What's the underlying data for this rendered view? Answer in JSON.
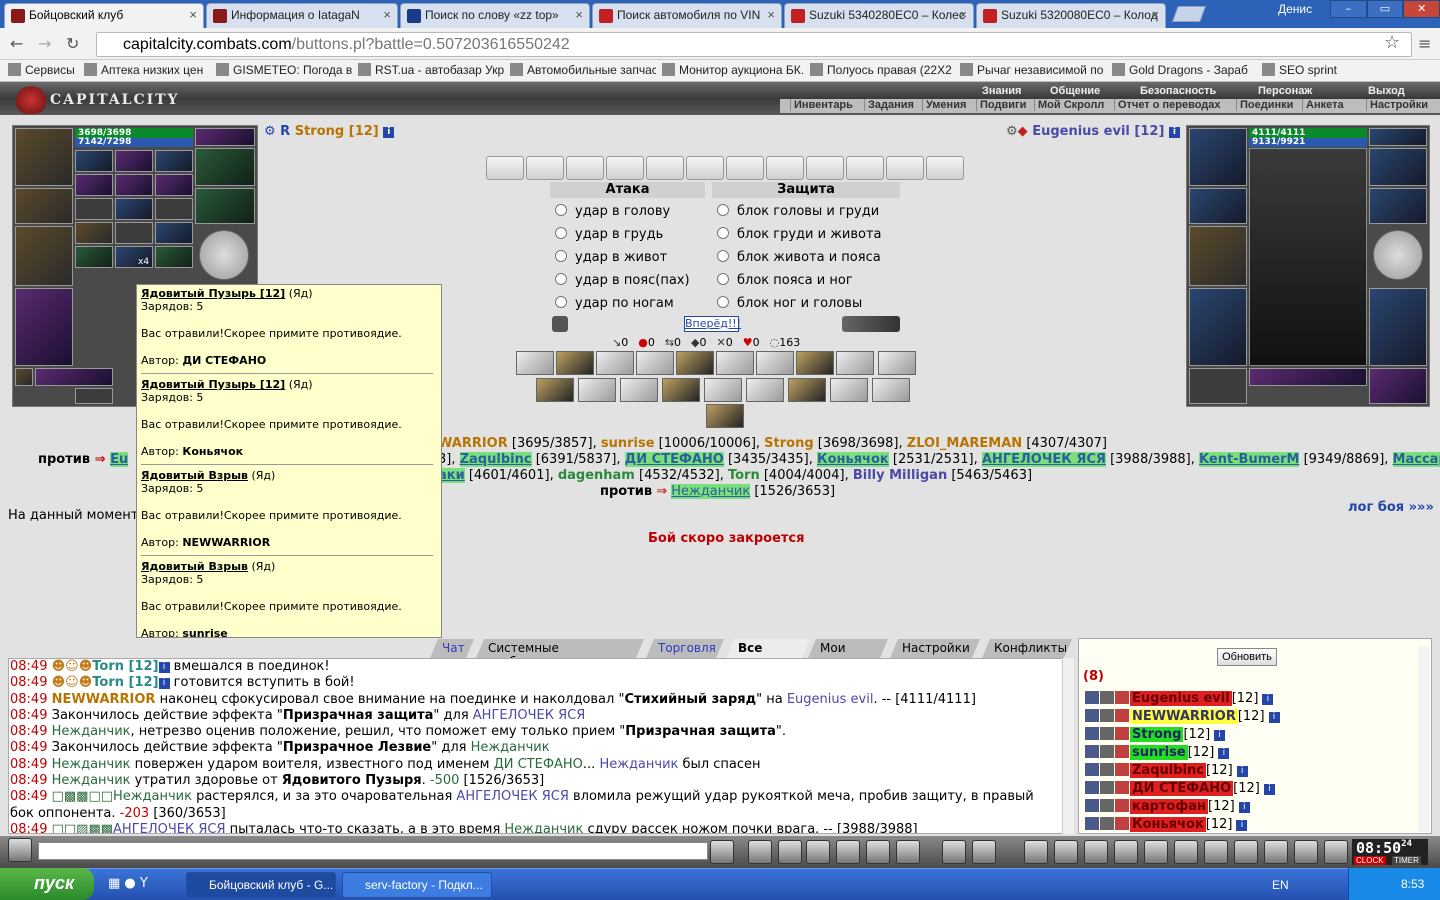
{
  "browser": {
    "tabs": [
      {
        "title": "Бойцовский клуб",
        "color": "#8a1a1a"
      },
      {
        "title": "Информация о IatagaN",
        "color": "#8a1a1a"
      },
      {
        "title": "Поиск по слову «zz top»",
        "color": "#1a3a8a"
      },
      {
        "title": "Поиск автомобиля по VIN",
        "color": "#c02020"
      },
      {
        "title": "Suzuki 5340280EC0 – Колес",
        "color": "#c02020"
      },
      {
        "title": "Suzuki 5320080EC0 – Колод",
        "color": "#c02020"
      }
    ],
    "user": "Денис",
    "url_host": "capitalcity.combats.com",
    "url_rest": "/buttons.pl?battle=0.507203616550242",
    "bookmarks": [
      "Сервисы",
      "Аптека низких цен",
      "GISMETEO: Погода в У",
      "RST.ua - автобазар Укр",
      "Автомобильные запчас",
      "Монитор аукциона БК.",
      "Полуось правая (22X2",
      "Рычаг независимой по",
      "Gold Dragons - Зараб",
      "SEO sprint"
    ]
  },
  "game": {
    "logo": "CAPITALCITY",
    "menu_top": [
      "Знания",
      "Общение",
      "Безопасность",
      "Персонаж",
      "Выход"
    ],
    "menu_bottom": [
      "Инвентарь",
      "Задания",
      "Умения",
      "Подвиги",
      "Мой Скролл",
      "Отчет о переводах",
      "Поединки",
      "Анкета",
      "Настройки"
    ],
    "left": {
      "hp": "3698/3698",
      "mp": "7142/7298",
      "name": "Strong",
      "level": "[12]",
      "count_badge": "x4"
    },
    "right": {
      "hp": "4111/4111",
      "mp": "9131/9921",
      "name": "Eugenius evil",
      "level": "[12]"
    },
    "attack": {
      "title": "Атака",
      "options": [
        "удар в голову",
        "удар в грудь",
        "удар в живот",
        "удар в пояс(пах)",
        "удар по ногам"
      ]
    },
    "defense": {
      "title": "Защита",
      "options": [
        "блок головы и груди",
        "блок груди и живота",
        "блок живота и пояса",
        "блок пояса и ног",
        "блок ног и головы"
      ]
    },
    "forward": "Вперёд!!!",
    "stats": [
      "0",
      "0",
      "0",
      "0",
      "0",
      "0",
      "163"
    ],
    "tooltip": [
      {
        "name": "Ядовитый Пузырь [12]",
        "type": "(Яд)",
        "charges": "Зарядов: 5",
        "desc": "Вас отравили!Скорее примите противоядие.",
        "author_label": "Автор:",
        "author": "ДИ СТЕФАНО"
      },
      {
        "name": "Ядовитый Пузырь [12]",
        "type": "(Яд)",
        "charges": "Зарядов: 5",
        "desc": "Вас отравили!Скорее примите противоядие.",
        "author_label": "Автор:",
        "author": "Коньячок"
      },
      {
        "name": "Ядовитый Взрыв",
        "type": "(Яд)",
        "charges": "Зарядов: 5",
        "desc": "Вас отравили!Скорее примите противоядие.",
        "author_label": "Автор:",
        "author": "NEWWARRIOR"
      },
      {
        "name": "Ядовитый Взрыв",
        "type": "(Яд)",
        "charges": "Зарядов: 5",
        "desc": "Вас отравили!Скорее примите противоядие.",
        "author_label": "Автор:",
        "author": "sunrise"
      }
    ],
    "roster": {
      "line1": [
        [
          "WARRIOR",
          "[3695/3857]"
        ],
        [
          "sunrise",
          "[10006/10006]"
        ],
        [
          "Strong",
          "[3698/3698]"
        ],
        [
          "ZLOI_MAREMAN",
          "[4307/4307]"
        ]
      ],
      "line2": [
        [
          "Zaqulbinc",
          "[6391/5837]"
        ],
        [
          "ДИ СТЕФАНО",
          "[3435/3435]"
        ],
        [
          "Коньячок",
          "[2531/2531]"
        ],
        [
          "АНГЕЛОЧЕК ЯСЯ",
          "[3988/3988]"
        ],
        [
          "Kent-BumerM",
          "[9349/8869]"
        ],
        [
          "Массар-"
        ]
      ],
      "line3": [
        [
          "аки",
          "[4601/4601]"
        ],
        [
          "dagenham",
          "[4532/4532]"
        ],
        [
          "Torn",
          "[4004/4004]"
        ],
        [
          "Billy Milligan",
          "[5463/5463]"
        ]
      ],
      "vs": "против",
      "vs_left_name": "Eu",
      "vs_name": "Нежданчик",
      "vs_hp": "[1526/3653]",
      "line2_prefix_hp": "3]"
    },
    "at_moment": "На данный момент",
    "log_link": "лог боя »»»",
    "closing": "Бой скоро закроется"
  },
  "chat_tabs": [
    "Чат",
    "Системные сообщения",
    "Торговля",
    "Все логи",
    "Мои логи",
    "Настройки",
    "Конфликты"
  ],
  "chat": [
    {
      "t": "08:49",
      "parts": [
        [
          "Torn [12]",
          "nk"
        ],
        [
          " вмешался в поединок!",
          ""
        ]
      ]
    },
    {
      "t": "08:49",
      "parts": [
        [
          "Torn [12]",
          "nk"
        ],
        [
          " готовится вступить в бой!",
          ""
        ]
      ]
    },
    {
      "t": "08:49",
      "parts": [
        [
          "NEWWARRIOR",
          "or"
        ],
        [
          " наконец сфокусировал свое внимание на поединке и наколдовал \"",
          ""
        ],
        [
          "Стихийный заряд",
          "b"
        ],
        [
          "\" на ",
          ""
        ],
        [
          "Eugenius evil",
          "bl"
        ],
        [
          ". -- [4111/4111]",
          ""
        ]
      ]
    },
    {
      "t": "08:49",
      "parts": [
        [
          "Закончилось действие эффекта \"",
          ""
        ],
        [
          "Призрачная защита",
          "b"
        ],
        [
          "\" для ",
          ""
        ],
        [
          "АНГЕЛОЧЕК ЯСЯ",
          "bl"
        ]
      ]
    },
    {
      "t": "08:49",
      "parts": [
        [
          "Нежданчик",
          "ppl"
        ],
        [
          ", нетрезво оценив положение, решил, что поможет ему только прием \"",
          ""
        ],
        [
          "Призрачная защита",
          "b"
        ],
        [
          "\".",
          ""
        ]
      ]
    },
    {
      "t": "08:49",
      "parts": [
        [
          "Закончилось действие эффекта \"",
          ""
        ],
        [
          "Призрачное Лезвие",
          "b"
        ],
        [
          "\" для ",
          ""
        ],
        [
          "Нежданчик",
          "ppl"
        ]
      ]
    },
    {
      "t": "08:49",
      "parts": [
        [
          "Нежданчик",
          "ppl"
        ],
        [
          " повержен ударом воителя, известного под именем ",
          ""
        ],
        [
          "ДИ СТЕФАНО",
          "ppl"
        ],
        [
          "... ",
          ""
        ],
        [
          "Нежданчик",
          "bl"
        ],
        [
          " был спасен",
          ""
        ]
      ]
    },
    {
      "t": "08:49",
      "parts": [
        [
          "Нежданчик",
          "ppl"
        ],
        [
          " утратил здоровье от ",
          ""
        ],
        [
          "Ядовитого Пузыря",
          "b"
        ],
        [
          ". ",
          ""
        ],
        [
          "-500",
          "ppl"
        ],
        [
          " [1526/3653]",
          ""
        ]
      ]
    },
    {
      "t": "08:49",
      "parts": [
        [
          "□▩▩□□",
          "ppl"
        ],
        [
          "Нежданчик",
          "ppl"
        ],
        [
          " растерялся, и за это очаровательная ",
          ""
        ],
        [
          "АНГЕЛОЧЕК ЯСЯ",
          "bl"
        ],
        [
          " вломила режущий удар рукояткой меча, пробив защиту, в правый",
          ""
        ]
      ]
    },
    {
      "t": "",
      "parts": [
        [
          "бок оппонента. ",
          ""
        ],
        [
          "-203",
          "red"
        ],
        [
          " [360/3653]",
          ""
        ]
      ]
    },
    {
      "t": "08:49",
      "parts": [
        [
          "□□▨▩▩",
          "ppl"
        ],
        [
          "АНГЕЛОЧЕК ЯСЯ",
          "bl"
        ],
        [
          " пыталась что-то сказать, а в это время ",
          ""
        ],
        [
          "Нежданчик",
          "ppl"
        ],
        [
          " сдуру рассек ножом почки врага. -- [3988/3988]",
          ""
        ]
      ]
    }
  ],
  "side": {
    "refresh": "Обновить",
    "count": "(8)",
    "players": [
      {
        "name": "Eugenius evil",
        "level": "[12]",
        "style": "nmr"
      },
      {
        "name": "NEWWARRIOR",
        "level": "[12]",
        "style": "nmy"
      },
      {
        "name": "Strong",
        "level": "[12]",
        "style": "nmg"
      },
      {
        "name": "sunrise",
        "level": "[12]",
        "style": "nmg"
      },
      {
        "name": "Zaqulbinc",
        "level": "[12]",
        "style": "nmr"
      },
      {
        "name": "ДИ СТЕФАНО",
        "level": "[12]",
        "style": "nmr"
      },
      {
        "name": "картофан",
        "level": "[12]",
        "style": "nmr"
      },
      {
        "name": "Коньячок",
        "level": "[12]",
        "style": "nmr"
      }
    ]
  },
  "clock": {
    "time": "08:50",
    "sec": "24",
    "clock_label": "CLOCK",
    "timer_label": "TIMER"
  },
  "taskbar": {
    "start": "пуск",
    "tasks": [
      "Бойцовский клуб - G...",
      "serv-factory - Подкл..."
    ],
    "lang": "EN",
    "time": "8:53"
  }
}
